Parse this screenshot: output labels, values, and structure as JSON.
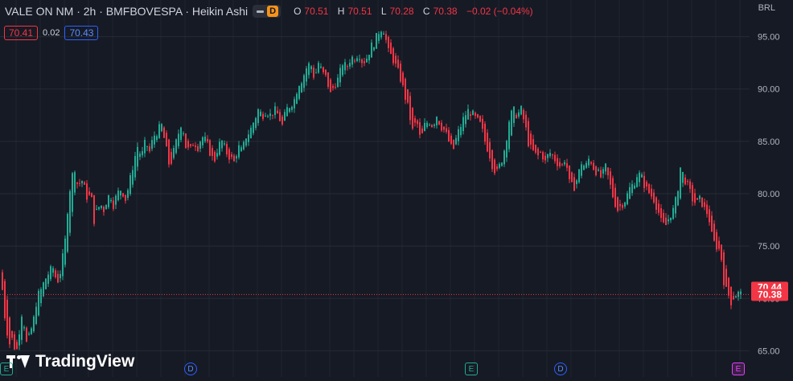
{
  "header": {
    "symbol": "VALE ON NM · 2h · BMFBOVESPA · Heikin Ashi",
    "interval_badge": "D",
    "ohlc": {
      "o_label": "O",
      "o": "70.51",
      "h_label": "H",
      "h": "70.51",
      "l_label": "L",
      "l": "70.28",
      "c_label": "C",
      "c": "70.38",
      "change": "−0.02 (−0.04%)"
    },
    "sell_price": "70.41",
    "spread": "0.02",
    "buy_price": "70.43",
    "currency": "BRL"
  },
  "logo": {
    "text": "TradingView"
  },
  "events": [
    "E",
    "D",
    "E",
    "D",
    "E"
  ],
  "price_labels": {
    "current": "70.38",
    "previous": "70.44"
  },
  "colors": {
    "up": "#22ab94",
    "down": "#f23645",
    "bg": "#161a25",
    "grid": "#2a2e39"
  },
  "chart_data": {
    "type": "candlestick",
    "chart_style": "Heikin Ashi",
    "ylim": [
      62.5,
      98.5
    ],
    "y_ticks": [
      "65.00",
      "70.00",
      "75.00",
      "80.00",
      "85.00",
      "90.00",
      "95.00"
    ],
    "last_price": 70.38,
    "prev_close_line": 70.44,
    "close_path": [
      [
        0,
        72.5
      ],
      [
        3,
        70.0
      ],
      [
        6,
        67.5
      ],
      [
        9,
        66.5
      ],
      [
        12,
        65.3
      ],
      [
        15,
        66.5
      ],
      [
        18,
        64.8
      ],
      [
        21,
        65.3
      ],
      [
        24,
        67.8
      ],
      [
        27,
        69.0
      ],
      [
        30,
        66.8
      ],
      [
        33,
        65.2
      ],
      [
        36,
        66.7
      ],
      [
        40,
        67.5
      ],
      [
        45,
        70.1
      ],
      [
        50,
        70.8
      ],
      [
        55,
        71.8
      ],
      [
        60,
        72.5
      ],
      [
        65,
        72.9
      ],
      [
        70,
        71.5
      ],
      [
        75,
        72.8
      ],
      [
        80,
        75.5
      ],
      [
        84,
        79.5
      ],
      [
        88,
        81.5
      ],
      [
        92,
        82.5
      ],
      [
        96,
        80.5
      ],
      [
        100,
        81.5
      ],
      [
        104,
        80.5
      ],
      [
        108,
        79.5
      ],
      [
        112,
        80.0
      ],
      [
        116,
        77.5
      ],
      [
        120,
        78.5
      ],
      [
        124,
        79.0
      ],
      [
        128,
        78.5
      ],
      [
        132,
        79.5
      ],
      [
        136,
        80.0
      ],
      [
        140,
        79.0
      ],
      [
        145,
        80.0
      ],
      [
        150,
        80.5
      ],
      [
        155,
        79.5
      ],
      [
        160,
        81.0
      ],
      [
        165,
        83.0
      ],
      [
        170,
        84.5
      ],
      [
        175,
        83.5
      ],
      [
        180,
        85.0
      ],
      [
        185,
        84.0
      ],
      [
        190,
        85.5
      ],
      [
        195,
        86.0
      ],
      [
        200,
        86.5
      ],
      [
        205,
        84.5
      ],
      [
        210,
        82.5
      ],
      [
        215,
        84.0
      ],
      [
        220,
        85.5
      ],
      [
        225,
        87.0
      ],
      [
        230,
        84.5
      ],
      [
        235,
        84.0
      ],
      [
        240,
        85.0
      ],
      [
        245,
        84.5
      ],
      [
        250,
        85.5
      ],
      [
        255,
        85.0
      ],
      [
        260,
        84.0
      ],
      [
        265,
        83.0
      ],
      [
        270,
        84.5
      ],
      [
        275,
        85.0
      ],
      [
        280,
        84.0
      ],
      [
        285,
        83.5
      ],
      [
        290,
        83.0
      ],
      [
        295,
        84.5
      ],
      [
        300,
        84.0
      ],
      [
        305,
        85.5
      ],
      [
        310,
        86.0
      ],
      [
        315,
        87.0
      ],
      [
        320,
        88.0
      ],
      [
        325,
        87.5
      ],
      [
        330,
        88.0
      ],
      [
        335,
        87.5
      ],
      [
        340,
        88.0
      ],
      [
        345,
        87.5
      ],
      [
        350,
        86.5
      ],
      [
        355,
        88.0
      ],
      [
        360,
        88.5
      ],
      [
        365,
        89.0
      ],
      [
        370,
        90.5
      ],
      [
        375,
        91.0
      ],
      [
        380,
        92.0
      ],
      [
        385,
        92.5
      ],
      [
        390,
        91.0
      ],
      [
        395,
        92.5
      ],
      [
        400,
        91.5
      ],
      [
        405,
        91.0
      ],
      [
        410,
        89.5
      ],
      [
        415,
        90.5
      ],
      [
        420,
        91.0
      ],
      [
        425,
        92.5
      ],
      [
        430,
        92.0
      ],
      [
        435,
        93.0
      ],
      [
        440,
        93.0
      ],
      [
        445,
        93.5
      ],
      [
        450,
        92.5
      ],
      [
        455,
        93.0
      ],
      [
        460,
        94.0
      ],
      [
        465,
        94.5
      ],
      [
        470,
        95.5
      ],
      [
        475,
        96.0
      ],
      [
        478,
        95.0
      ],
      [
        482,
        93.5
      ],
      [
        487,
        93.0
      ],
      [
        492,
        92.0
      ],
      [
        497,
        91.0
      ],
      [
        502,
        89.5
      ],
      [
        507,
        88.0
      ],
      [
        512,
        86.0
      ],
      [
        517,
        87.0
      ],
      [
        522,
        85.0
      ],
      [
        527,
        86.5
      ],
      [
        532,
        87.0
      ],
      [
        537,
        86.5
      ],
      [
        542,
        87.5
      ],
      [
        547,
        86.5
      ],
      [
        552,
        86.0
      ],
      [
        557,
        85.0
      ],
      [
        562,
        84.0
      ],
      [
        567,
        85.5
      ],
      [
        572,
        86.5
      ],
      [
        577,
        87.5
      ],
      [
        582,
        88.0
      ],
      [
        587,
        87.5
      ],
      [
        592,
        87.0
      ],
      [
        597,
        86.5
      ],
      [
        602,
        85.0
      ],
      [
        607,
        84.0
      ],
      [
        612,
        82.5
      ],
      [
        617,
        82.0
      ],
      [
        622,
        83.0
      ],
      [
        627,
        84.5
      ],
      [
        632,
        87.0
      ],
      [
        637,
        88.0
      ],
      [
        642,
        87.5
      ],
      [
        647,
        88.0
      ],
      [
        652,
        86.5
      ],
      [
        657,
        84.5
      ],
      [
        662,
        84.0
      ],
      [
        667,
        83.5
      ],
      [
        672,
        84.0
      ],
      [
        677,
        83.0
      ],
      [
        682,
        84.0
      ],
      [
        687,
        83.5
      ],
      [
        692,
        83.0
      ],
      [
        697,
        82.5
      ],
      [
        702,
        83.5
      ],
      [
        707,
        81.0
      ],
      [
        712,
        80.5
      ],
      [
        717,
        81.5
      ],
      [
        722,
        83.0
      ],
      [
        727,
        82.5
      ],
      [
        732,
        83.5
      ],
      [
        737,
        82.5
      ],
      [
        742,
        82.0
      ],
      [
        747,
        81.5
      ],
      [
        752,
        82.5
      ],
      [
        757,
        81.0
      ],
      [
        762,
        79.5
      ],
      [
        767,
        78.5
      ],
      [
        772,
        79.0
      ],
      [
        777,
        79.5
      ],
      [
        782,
        80.5
      ],
      [
        787,
        81.0
      ],
      [
        792,
        82.0
      ],
      [
        797,
        81.5
      ],
      [
        802,
        80.5
      ],
      [
        807,
        80.0
      ],
      [
        812,
        79.5
      ],
      [
        817,
        78.5
      ],
      [
        822,
        77.0
      ],
      [
        827,
        77.0
      ],
      [
        832,
        78.0
      ],
      [
        837,
        78.5
      ],
      [
        841,
        80.0
      ],
      [
        845,
        82.5
      ],
      [
        850,
        81.5
      ],
      [
        855,
        80.5
      ],
      [
        860,
        79.5
      ],
      [
        865,
        79.0
      ],
      [
        870,
        79.5
      ],
      [
        875,
        78.5
      ],
      [
        880,
        78.0
      ],
      [
        885,
        75.5
      ],
      [
        890,
        75.0
      ],
      [
        895,
        74.5
      ],
      [
        900,
        71.0
      ],
      [
        904,
        70.5
      ],
      [
        908,
        69.7
      ],
      [
        912,
        70.3
      ],
      [
        916,
        70.5
      ],
      [
        920,
        70.38
      ]
    ]
  }
}
